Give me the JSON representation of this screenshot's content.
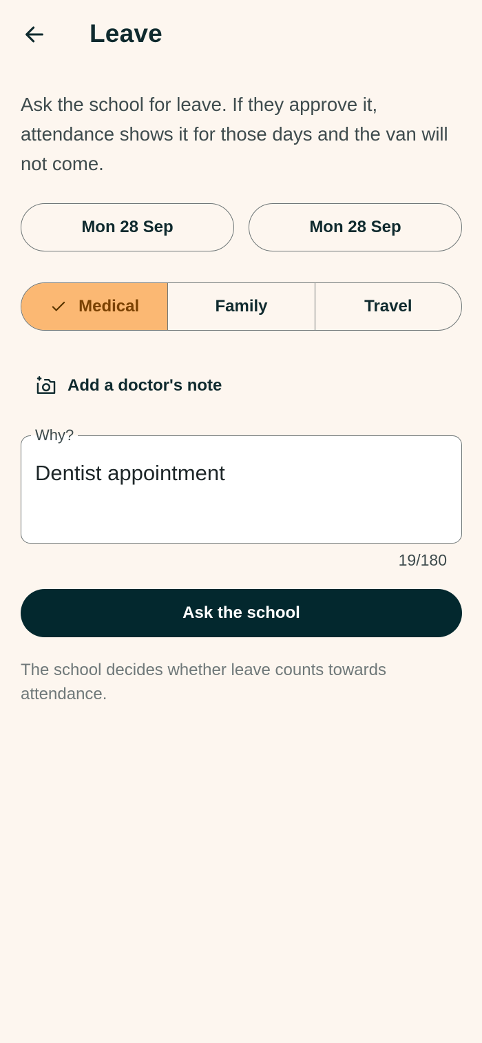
{
  "header": {
    "back_icon": "arrow-left-icon",
    "title": "Leave"
  },
  "intro": "Ask the school for leave. If they approve it, attendance shows it for those days and the van will not come.",
  "dates": {
    "start": "Mon 28 Sep",
    "end": "Mon 28 Sep"
  },
  "reasons": {
    "options": [
      "Medical",
      "Family",
      "Travel"
    ],
    "selected": "Medical",
    "selected_icon": "check-icon"
  },
  "attachment": {
    "icon": "add-photo-icon",
    "label": "Add a doctor's note"
  },
  "why_field": {
    "label": "Why?",
    "value": "Dentist appointment",
    "counter": "19/180"
  },
  "submit_label": "Ask the school",
  "footnote": "The school decides whether leave counts towards attendance.",
  "colors": {
    "background": "#fdf6ef",
    "selected_chip": "#fbb873",
    "selected_chip_text": "#7a4100",
    "primary_button": "#03282e",
    "text_primary": "#0f2a2e"
  }
}
